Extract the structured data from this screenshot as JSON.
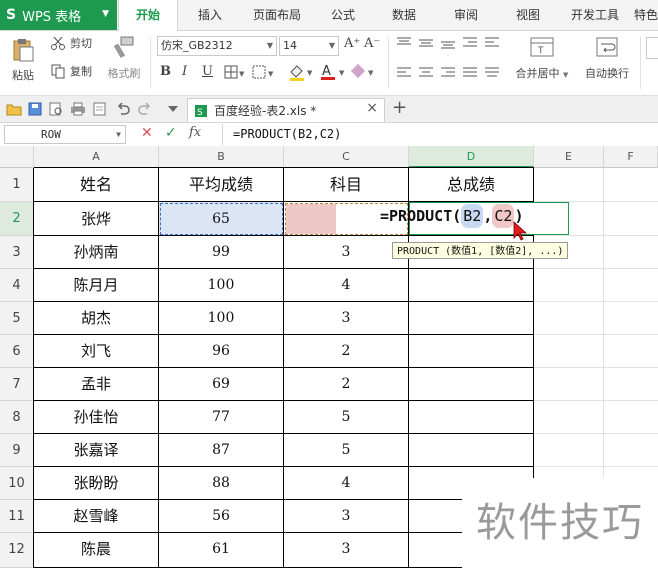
{
  "app": {
    "logo": "S",
    "name": "WPS 表格",
    "caret": "▼"
  },
  "menu": {
    "tabs": [
      {
        "label": "开始",
        "active": true
      },
      {
        "label": "插入"
      },
      {
        "label": "页面布局"
      },
      {
        "label": "公式"
      },
      {
        "label": "数据"
      },
      {
        "label": "审阅"
      },
      {
        "label": "视图"
      },
      {
        "label": "开发工具"
      },
      {
        "label": "特色"
      }
    ]
  },
  "ribbon": {
    "paste": "粘贴",
    "cut": "剪切",
    "copy": "复制",
    "format_painter": "格式刷",
    "font_name": "仿宋_GB2312",
    "font_size": "14",
    "bold": "B",
    "italic": "I",
    "underline": "U",
    "merge_center": "合并居中",
    "wrap_text": "自动换行",
    "caret": "▼",
    "grow_font": "A⁺",
    "shrink_font": "A⁻"
  },
  "doc_tab": {
    "title": "百度经验-表2.xls *",
    "close": "×",
    "add": "+"
  },
  "formula_bar": {
    "name_box": "ROW",
    "cancel": "✕",
    "confirm": "✓",
    "fx": "fx",
    "formula": "=PRODUCT(B2,C2)"
  },
  "columns": [
    "A",
    "B",
    "C",
    "D",
    "E",
    "F"
  ],
  "rows": [
    "1",
    "2",
    "3",
    "4",
    "5",
    "6",
    "7",
    "8",
    "9",
    "10",
    "11",
    "12"
  ],
  "table": {
    "headers": [
      "姓名",
      "平均成绩",
      "科目",
      "总成绩"
    ],
    "rows": [
      [
        "张烨",
        "65",
        "",
        ""
      ],
      [
        "孙炳南",
        "99",
        "3",
        ""
      ],
      [
        "陈月月",
        "100",
        "4",
        ""
      ],
      [
        "胡杰",
        "100",
        "3",
        ""
      ],
      [
        "刘飞",
        "96",
        "2",
        ""
      ],
      [
        "孟非",
        "69",
        "2",
        ""
      ],
      [
        "孙佳怡",
        "77",
        "5",
        ""
      ],
      [
        "张嘉译",
        "87",
        "5",
        ""
      ],
      [
        "张盼盼",
        "88",
        "4",
        ""
      ],
      [
        "赵雪峰",
        "56",
        "3",
        ""
      ],
      [
        "陈晨",
        "61",
        "3",
        ""
      ]
    ]
  },
  "cell_edit": {
    "prefix": "=PRODUCT(",
    "ref1": "B2",
    "sep": ",",
    "ref2": "C2",
    "suffix": ")"
  },
  "tooltip": "PRODUCT (数值1, [数值2], ...)",
  "watermark": "软件技巧",
  "colors": {
    "brand": "#1d9a4f",
    "ref_b": "#c9d9f1",
    "ref_c": "#f1c7c7",
    "tooltip_bg": "#ffffe1",
    "cancel": "#d9534f",
    "confirm": "#2b9a4f"
  }
}
